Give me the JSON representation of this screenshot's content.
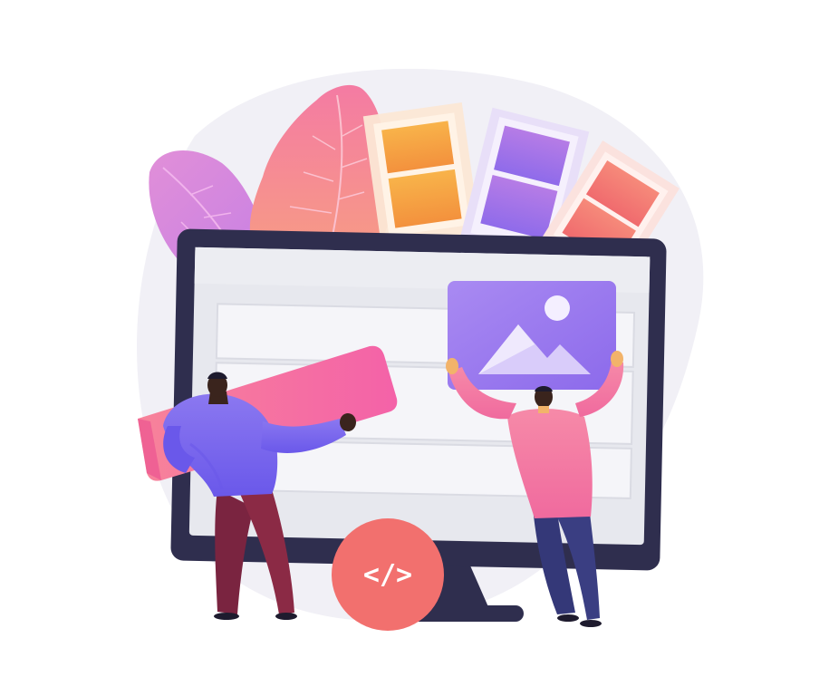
{
  "illustration": {
    "code_badge": {
      "text": "</>",
      "icon": "code-icon"
    },
    "monitor_image_icon": "image-icon",
    "colors": {
      "background_blob": "#F1F0F6",
      "monitor_frame": "#2F2E4E",
      "screen": "#E7E8EE",
      "pink_leaf": "#F7839A",
      "violet_leaf": "#D98BDF",
      "orange_swatch": "#F6A540",
      "purple_swatch": "#A074E8",
      "coral_swatch": "#F27D78",
      "image_card": "#9E7CF0",
      "pink_banner": "#F76CA2",
      "person_left_shirt": "#7B66EF",
      "person_left_pants": "#8B2A45",
      "person_right_shirt": "#F47BA5",
      "person_right_pants": "#3A3E82",
      "skin": "#3A241D",
      "code_badge": "#F2706E"
    }
  }
}
